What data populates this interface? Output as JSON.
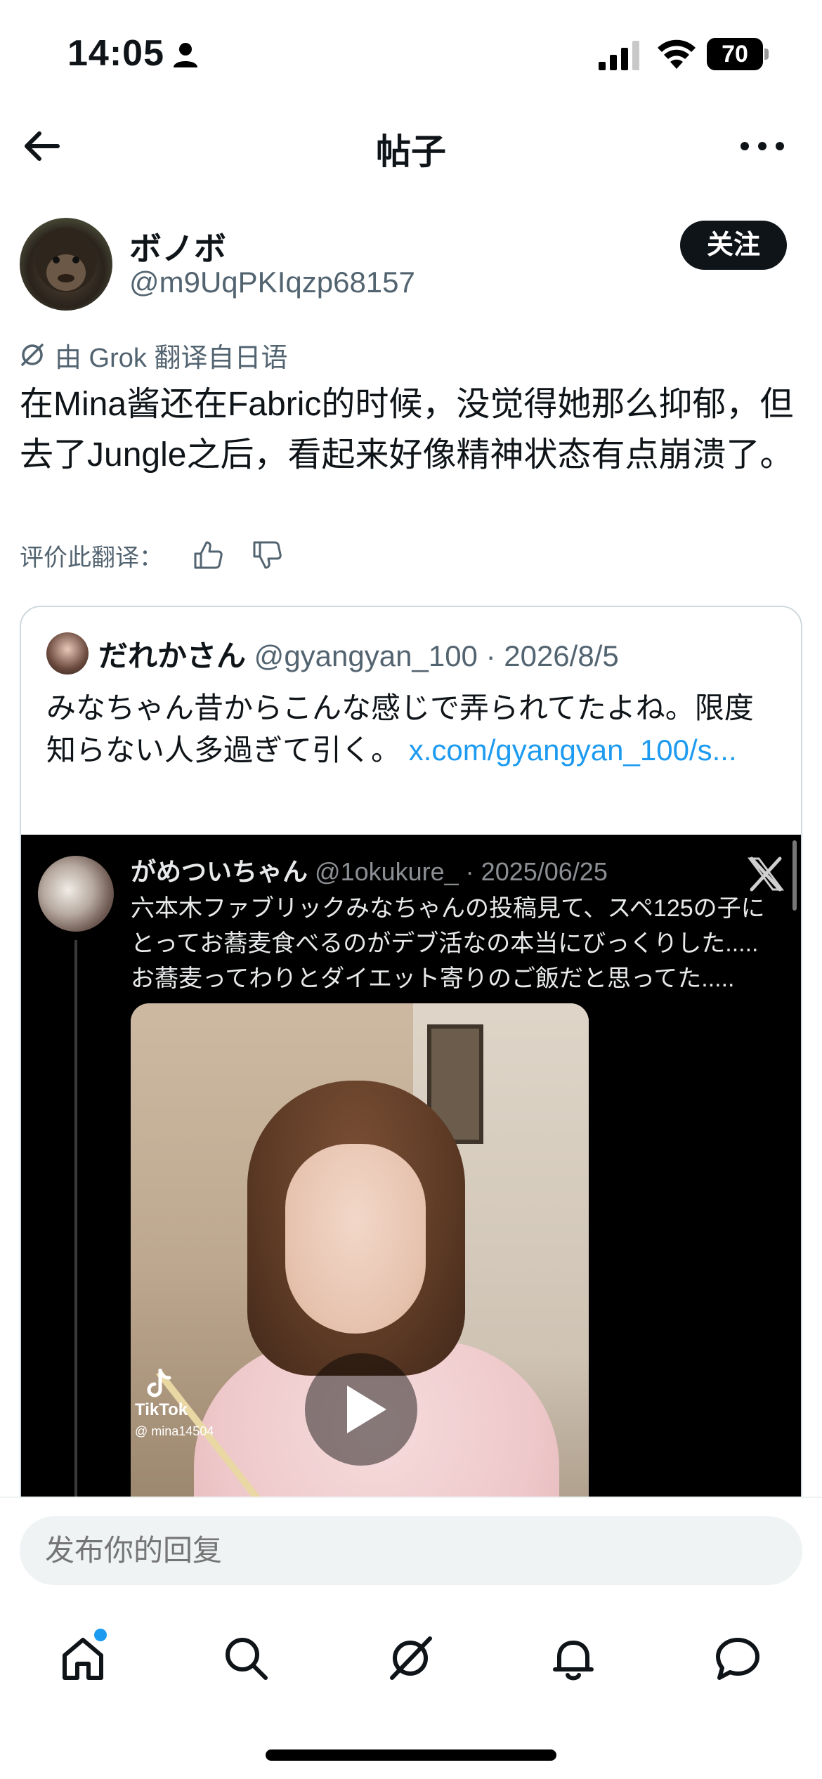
{
  "status_bar": {
    "time": "14:05",
    "battery": "70"
  },
  "header": {
    "title": "帖子"
  },
  "author": {
    "display_name": "ボノボ",
    "handle": "@m9UqPKIqzp68157",
    "follow_label": "关注"
  },
  "translation": {
    "note": "由 Grok 翻译自日语",
    "rate_label": "评价此翻译："
  },
  "post": {
    "text": "在Mina酱还在Fabric的时候，没觉得她那么抑郁，但去了Jungle之后，看起来好像精神状态有点崩溃了。"
  },
  "quote": {
    "name": "だれかさん",
    "meta": " @gyangyan_100 · 2026/8/5",
    "text": "みなちゃん昔からこんな感じで弄られてたよね。限度知らない人多過ぎて引く。",
    "link": "x.com/gyangyan_100/s..."
  },
  "embedded": {
    "name": "がめついちゃん",
    "meta": " @1okukure_ · 2025/06/25",
    "line1": "六本木ファブリックみなちゃんの投稿見て、スペ125の子に",
    "line2": "とってお蕎麦食べるのがデブ活なの本当にびっくりした.....",
    "line3": "お蕎麦ってわりとダイエット寄りのご飯だと思ってた.....",
    "tiktok_label": "TikTok",
    "tiktok_user": "@ mina14504"
  },
  "reply": {
    "placeholder": "发布你的回复"
  },
  "tabs": [
    {
      "icon": "home-icon"
    },
    {
      "icon": "search-icon"
    },
    {
      "icon": "grok-icon"
    },
    {
      "icon": "bell-icon"
    },
    {
      "icon": "messages-icon"
    }
  ],
  "colors": {
    "accent": "#1d9bf0",
    "text_primary": "#0f1419",
    "text_secondary": "#536471"
  }
}
